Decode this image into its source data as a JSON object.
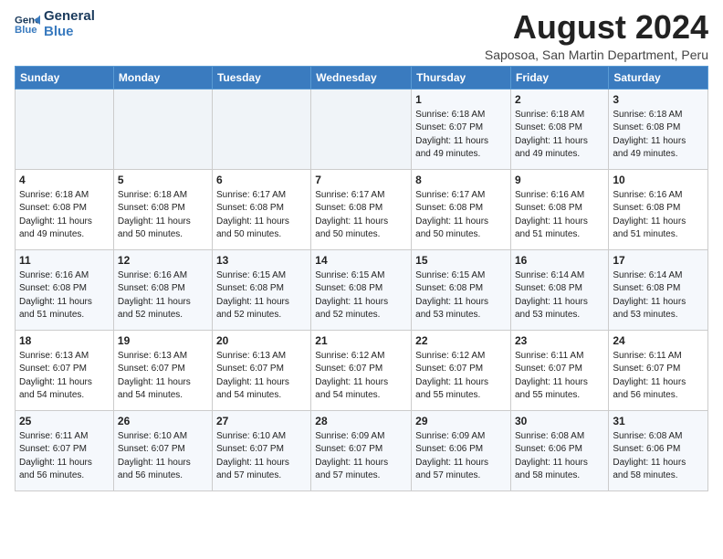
{
  "logo": {
    "line1": "General",
    "line2": "Blue"
  },
  "title": "August 2024",
  "subtitle": "Saposoa, San Martin Department, Peru",
  "days_header": [
    "Sunday",
    "Monday",
    "Tuesday",
    "Wednesday",
    "Thursday",
    "Friday",
    "Saturday"
  ],
  "weeks": [
    [
      {
        "day": "",
        "info": ""
      },
      {
        "day": "",
        "info": ""
      },
      {
        "day": "",
        "info": ""
      },
      {
        "day": "",
        "info": ""
      },
      {
        "day": "1",
        "info": "Sunrise: 6:18 AM\nSunset: 6:07 PM\nDaylight: 11 hours\nand 49 minutes."
      },
      {
        "day": "2",
        "info": "Sunrise: 6:18 AM\nSunset: 6:08 PM\nDaylight: 11 hours\nand 49 minutes."
      },
      {
        "day": "3",
        "info": "Sunrise: 6:18 AM\nSunset: 6:08 PM\nDaylight: 11 hours\nand 49 minutes."
      }
    ],
    [
      {
        "day": "4",
        "info": "Sunrise: 6:18 AM\nSunset: 6:08 PM\nDaylight: 11 hours\nand 49 minutes."
      },
      {
        "day": "5",
        "info": "Sunrise: 6:18 AM\nSunset: 6:08 PM\nDaylight: 11 hours\nand 50 minutes."
      },
      {
        "day": "6",
        "info": "Sunrise: 6:17 AM\nSunset: 6:08 PM\nDaylight: 11 hours\nand 50 minutes."
      },
      {
        "day": "7",
        "info": "Sunrise: 6:17 AM\nSunset: 6:08 PM\nDaylight: 11 hours\nand 50 minutes."
      },
      {
        "day": "8",
        "info": "Sunrise: 6:17 AM\nSunset: 6:08 PM\nDaylight: 11 hours\nand 50 minutes."
      },
      {
        "day": "9",
        "info": "Sunrise: 6:16 AM\nSunset: 6:08 PM\nDaylight: 11 hours\nand 51 minutes."
      },
      {
        "day": "10",
        "info": "Sunrise: 6:16 AM\nSunset: 6:08 PM\nDaylight: 11 hours\nand 51 minutes."
      }
    ],
    [
      {
        "day": "11",
        "info": "Sunrise: 6:16 AM\nSunset: 6:08 PM\nDaylight: 11 hours\nand 51 minutes."
      },
      {
        "day": "12",
        "info": "Sunrise: 6:16 AM\nSunset: 6:08 PM\nDaylight: 11 hours\nand 52 minutes."
      },
      {
        "day": "13",
        "info": "Sunrise: 6:15 AM\nSunset: 6:08 PM\nDaylight: 11 hours\nand 52 minutes."
      },
      {
        "day": "14",
        "info": "Sunrise: 6:15 AM\nSunset: 6:08 PM\nDaylight: 11 hours\nand 52 minutes."
      },
      {
        "day": "15",
        "info": "Sunrise: 6:15 AM\nSunset: 6:08 PM\nDaylight: 11 hours\nand 53 minutes."
      },
      {
        "day": "16",
        "info": "Sunrise: 6:14 AM\nSunset: 6:08 PM\nDaylight: 11 hours\nand 53 minutes."
      },
      {
        "day": "17",
        "info": "Sunrise: 6:14 AM\nSunset: 6:08 PM\nDaylight: 11 hours\nand 53 minutes."
      }
    ],
    [
      {
        "day": "18",
        "info": "Sunrise: 6:13 AM\nSunset: 6:07 PM\nDaylight: 11 hours\nand 54 minutes."
      },
      {
        "day": "19",
        "info": "Sunrise: 6:13 AM\nSunset: 6:07 PM\nDaylight: 11 hours\nand 54 minutes."
      },
      {
        "day": "20",
        "info": "Sunrise: 6:13 AM\nSunset: 6:07 PM\nDaylight: 11 hours\nand 54 minutes."
      },
      {
        "day": "21",
        "info": "Sunrise: 6:12 AM\nSunset: 6:07 PM\nDaylight: 11 hours\nand 54 minutes."
      },
      {
        "day": "22",
        "info": "Sunrise: 6:12 AM\nSunset: 6:07 PM\nDaylight: 11 hours\nand 55 minutes."
      },
      {
        "day": "23",
        "info": "Sunrise: 6:11 AM\nSunset: 6:07 PM\nDaylight: 11 hours\nand 55 minutes."
      },
      {
        "day": "24",
        "info": "Sunrise: 6:11 AM\nSunset: 6:07 PM\nDaylight: 11 hours\nand 56 minutes."
      }
    ],
    [
      {
        "day": "25",
        "info": "Sunrise: 6:11 AM\nSunset: 6:07 PM\nDaylight: 11 hours\nand 56 minutes."
      },
      {
        "day": "26",
        "info": "Sunrise: 6:10 AM\nSunset: 6:07 PM\nDaylight: 11 hours\nand 56 minutes."
      },
      {
        "day": "27",
        "info": "Sunrise: 6:10 AM\nSunset: 6:07 PM\nDaylight: 11 hours\nand 57 minutes."
      },
      {
        "day": "28",
        "info": "Sunrise: 6:09 AM\nSunset: 6:07 PM\nDaylight: 11 hours\nand 57 minutes."
      },
      {
        "day": "29",
        "info": "Sunrise: 6:09 AM\nSunset: 6:06 PM\nDaylight: 11 hours\nand 57 minutes."
      },
      {
        "day": "30",
        "info": "Sunrise: 6:08 AM\nSunset: 6:06 PM\nDaylight: 11 hours\nand 58 minutes."
      },
      {
        "day": "31",
        "info": "Sunrise: 6:08 AM\nSunset: 6:06 PM\nDaylight: 11 hours\nand 58 minutes."
      }
    ]
  ]
}
